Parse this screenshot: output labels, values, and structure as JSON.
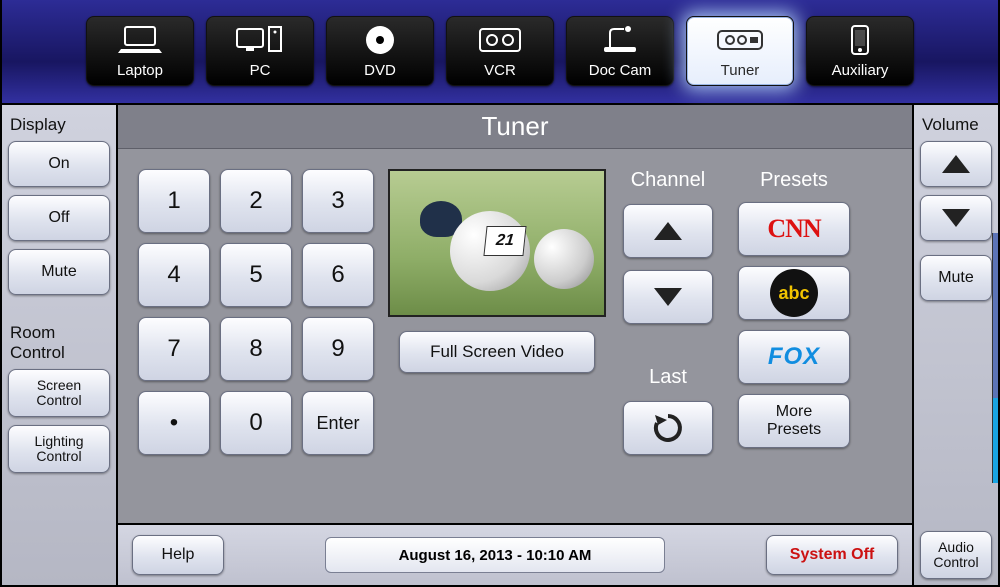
{
  "sources": [
    {
      "id": "laptop",
      "label": "Laptop",
      "active": false
    },
    {
      "id": "pc",
      "label": "PC",
      "active": false
    },
    {
      "id": "dvd",
      "label": "DVD",
      "active": false
    },
    {
      "id": "vcr",
      "label": "VCR",
      "active": false
    },
    {
      "id": "doccam",
      "label": "Doc Cam",
      "active": false
    },
    {
      "id": "tuner",
      "label": "Tuner",
      "active": true
    },
    {
      "id": "auxiliary",
      "label": "Auxiliary",
      "active": false
    }
  ],
  "left_panel": {
    "display_label": "Display",
    "on": "On",
    "off": "Off",
    "mute": "Mute",
    "room_control_label": "Room\nControl",
    "screen_control": "Screen\nControl",
    "lighting_control": "Lighting\nControl"
  },
  "center": {
    "title": "Tuner",
    "keypad": [
      "1",
      "2",
      "3",
      "4",
      "5",
      "6",
      "7",
      "8",
      "9",
      "•",
      "0",
      "Enter"
    ],
    "full_screen": "Full Screen Video",
    "channel_label": "Channel",
    "last_label": "Last",
    "presets_label": "Presets",
    "presets": [
      "CNN",
      "abc",
      "FOX"
    ],
    "more_presets": "More\nPresets",
    "preview_jersey": "21"
  },
  "bottom": {
    "help": "Help",
    "datetime": "August 16, 2013 - 10:10 AM",
    "system_off": "System Off"
  },
  "right_panel": {
    "volume_label": "Volume",
    "mute": "Mute",
    "audio_control": "Audio\nControl",
    "volume_level_pct": 34
  }
}
